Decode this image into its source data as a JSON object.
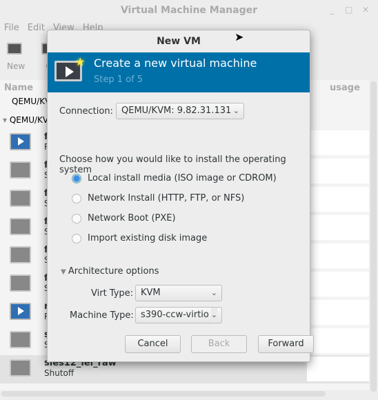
{
  "window": {
    "title": "Virtual Machine Manager"
  },
  "menu": [
    "File",
    "Edit",
    "View",
    "Help"
  ],
  "toolbar": {
    "new_label": "New",
    "open_label": "O"
  },
  "list": {
    "col_name": "Name",
    "col_usage": "usage",
    "conn1": "QEMU/KVI",
    "conn2": "QEMU/KVI",
    "rows": [
      {
        "name": "f",
        "status": "R",
        "running": true
      },
      {
        "name": "f",
        "status": "S",
        "running": false
      },
      {
        "name": "f",
        "status": "S",
        "running": false
      },
      {
        "name": "f",
        "status": "S",
        "running": false
      },
      {
        "name": "f",
        "status": "S",
        "running": false
      },
      {
        "name": "f",
        "status": "S",
        "running": false
      },
      {
        "name": "r",
        "status": "R",
        "running": true
      },
      {
        "name": "s",
        "status": "S",
        "running": false
      },
      {
        "name": "sles12_lei_raw",
        "status": "Shutoff",
        "running": false
      }
    ]
  },
  "dialog": {
    "title": "New VM",
    "header_title": "Create a new virtual machine",
    "header_step": "Step 1 of 5",
    "connection_label": "Connection:",
    "connection_value": "QEMU/KVM: 9.82.31.131",
    "install_prompt": "Choose how you would like to install the operating system",
    "options": [
      "Local install media (ISO image or CDROM)",
      "Network Install (HTTP, FTP, or NFS)",
      "Network Boot (PXE)",
      "Import existing disk image"
    ],
    "selected_option": 0,
    "arch_label": "Architecture options",
    "virt_type_label": "Virt Type:",
    "virt_type_value": "KVM",
    "machine_type_label": "Machine Type:",
    "machine_type_value": "s390-ccw-virtio",
    "cancel": "Cancel",
    "back": "Back",
    "forward": "Forward"
  },
  "colors": {
    "header": "#0070a8",
    "radio_selected": "#3a8de0"
  }
}
